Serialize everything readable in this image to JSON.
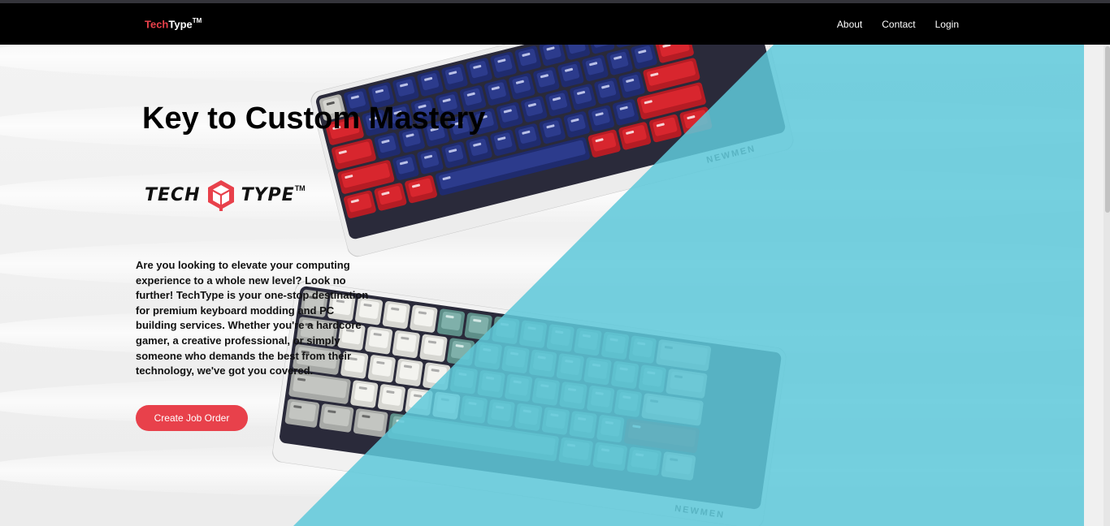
{
  "nav": {
    "brand": {
      "part1": "Tech",
      "part2": "Type",
      "tm": "TM"
    },
    "links": [
      "About",
      "Contact",
      "Login"
    ]
  },
  "hero": {
    "title": "Key to Custom Mastery",
    "logo": {
      "left": "TECH",
      "right": "TYPE",
      "tm": "TM",
      "icon": "cube-icon"
    },
    "description": "Are you looking to elevate your computing experience to a whole new level? Look no further! TechType is your one-stop destination for premium keyboard modding and PC building services. Whether you're a hardcore gamer, a creative professional, or simply someone who demands the best from their technology, we've got you covered.",
    "cta": "Create Job Order"
  },
  "colors": {
    "accent": "#e8414b",
    "teal": "#5ec8da",
    "nav_bg": "#000000",
    "keycap_blue": "#2c3b8c",
    "keycap_red": "#d8262e"
  },
  "keyboards": {
    "brand_label": "NEWMEN"
  }
}
